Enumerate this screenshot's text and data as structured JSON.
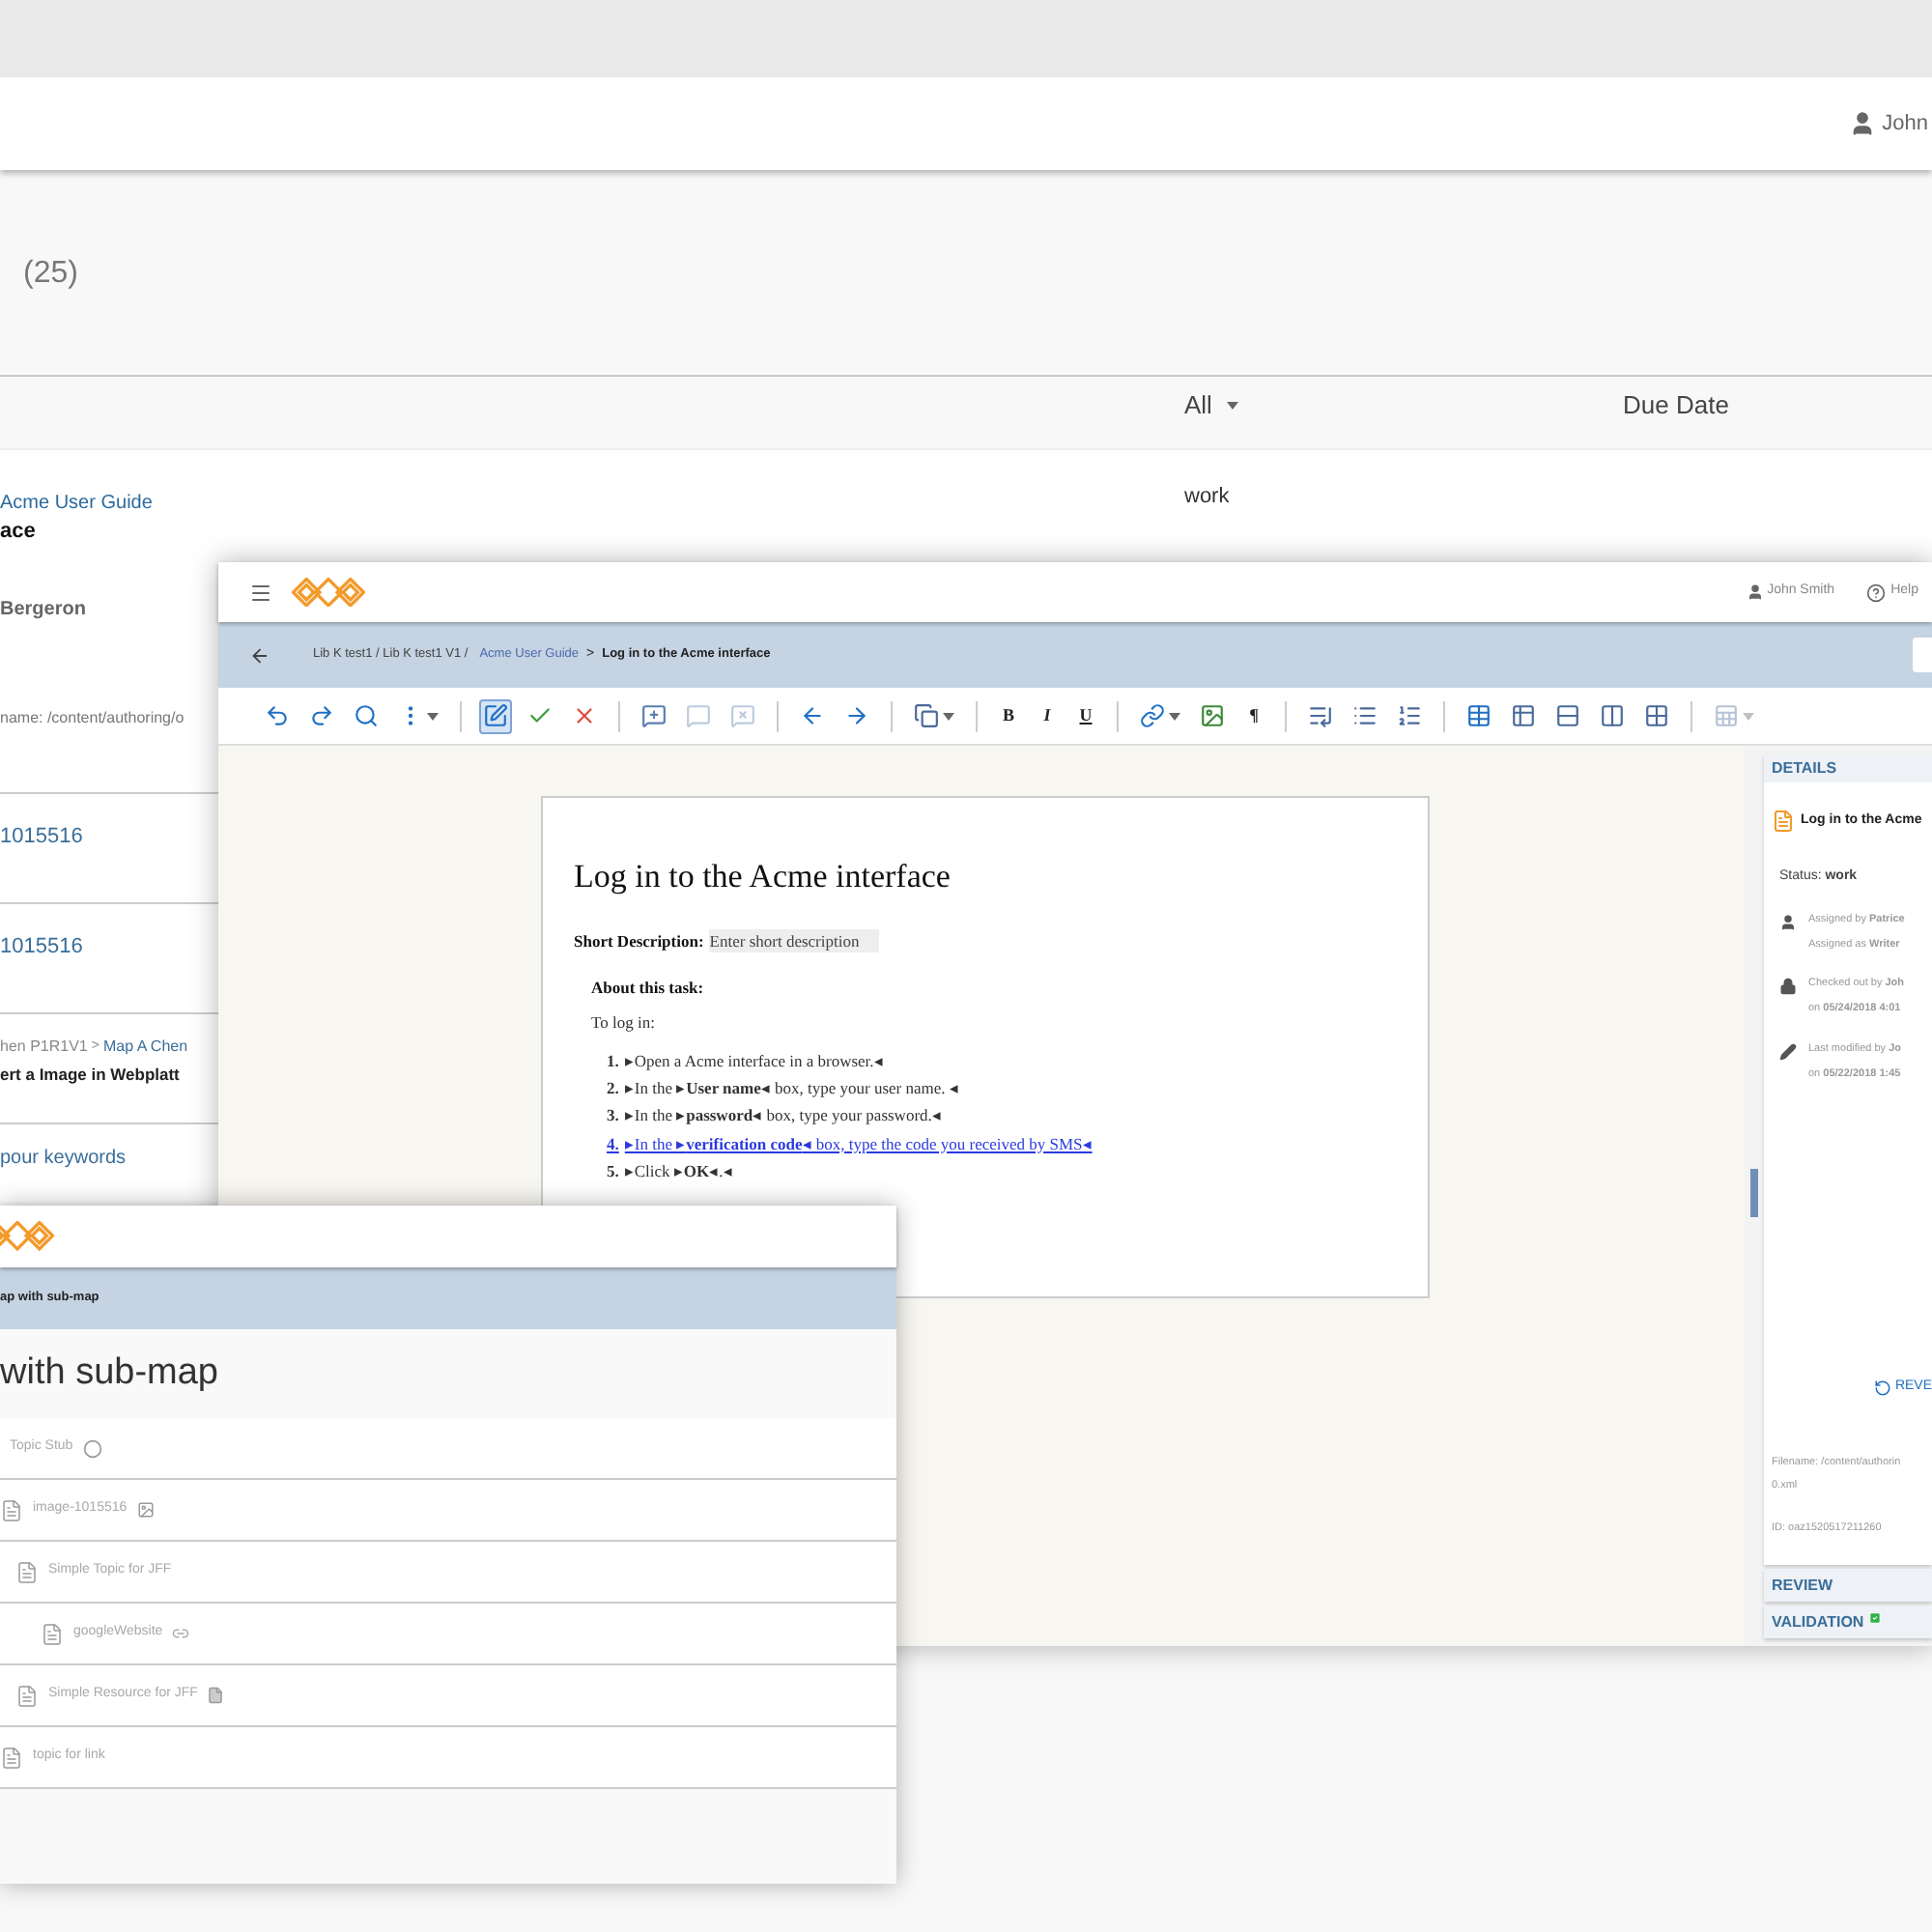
{
  "background_window": {
    "user": "John",
    "count": "(25)",
    "columns": [
      {
        "label": "All",
        "dropdown": true
      },
      {
        "label": "Due Date",
        "dropdown": false
      }
    ],
    "rows": [
      {
        "map": "Acme User Guide",
        "title": "ace",
        "status": "work",
        "author": "Bergeron",
        "filename": "name: /content/authoring/o"
      },
      {
        "title": "1015516",
        "kind": "link"
      },
      {
        "title": "1015516",
        "kind": "link"
      },
      {
        "path": "hen P1R1V1",
        "separator": ">",
        "map": "Map A Chen",
        "title": "ert a Image in Webplatt"
      },
      {
        "title": "pour keywords",
        "kind": "link"
      }
    ]
  },
  "editor_window": {
    "user": "John Smith",
    "help": "Help",
    "breadcrumb": {
      "path": "Lib K test1 / Lib K test1 V1 /",
      "link": "Acme User Guide",
      "separator": ">",
      "current": "Log in to the Acme interface"
    },
    "toolbar": [
      {
        "kind": "icon",
        "selected": false,
        "disabled": false,
        "dropdown": false
      },
      {
        "kind": "icon",
        "selected": false,
        "disabled": false,
        "dropdown": false
      },
      {
        "kind": "icon",
        "selected": false,
        "disabled": false,
        "dropdown": false
      },
      {
        "kind": "icon",
        "selected": false,
        "disabled": false,
        "dropdown": true
      },
      {
        "kind": "separator"
      },
      {
        "kind": "icon",
        "selected": true,
        "disabled": false,
        "dropdown": false
      },
      {
        "kind": "icon",
        "selected": false,
        "disabled": false,
        "dropdown": false
      },
      {
        "kind": "icon",
        "selected": false,
        "disabled": false,
        "dropdown": false
      },
      {
        "kind": "separator"
      },
      {
        "kind": "icon",
        "selected": false,
        "disabled": false,
        "dropdown": false
      },
      {
        "kind": "icon",
        "selected": false,
        "disabled": true,
        "dropdown": false
      },
      {
        "kind": "icon",
        "selected": false,
        "disabled": true,
        "dropdown": false
      },
      {
        "kind": "separator"
      },
      {
        "kind": "icon",
        "selected": false,
        "disabled": false,
        "dropdown": false
      },
      {
        "kind": "icon",
        "selected": false,
        "disabled": false,
        "dropdown": false
      },
      {
        "kind": "separator"
      },
      {
        "kind": "icon",
        "selected": false,
        "disabled": false,
        "dropdown": true
      },
      {
        "kind": "separator"
      },
      {
        "kind": "text",
        "label": "B"
      },
      {
        "kind": "text",
        "label": "I"
      },
      {
        "kind": "text",
        "label": "U"
      },
      {
        "kind": "separator"
      },
      {
        "kind": "icon",
        "selected": false,
        "disabled": false,
        "dropdown": true
      },
      {
        "kind": "icon",
        "selected": false,
        "disabled": false,
        "dropdown": false
      },
      {
        "kind": "text",
        "label": "¶"
      },
      {
        "kind": "separator"
      },
      {
        "kind": "icon",
        "selected": false,
        "disabled": false,
        "dropdown": false
      },
      {
        "kind": "icon",
        "selected": false,
        "disabled": false,
        "dropdown": false
      },
      {
        "kind": "icon",
        "selected": false,
        "disabled": false,
        "dropdown": false
      },
      {
        "kind": "separator"
      },
      {
        "kind": "icon",
        "selected": false,
        "disabled": false,
        "dropdown": false
      },
      {
        "kind": "icon",
        "selected": false,
        "disabled": false,
        "dropdown": false
      },
      {
        "kind": "icon",
        "selected": false,
        "disabled": false,
        "dropdown": false
      },
      {
        "kind": "icon",
        "selected": false,
        "disabled": false,
        "dropdown": false
      },
      {
        "kind": "icon",
        "selected": false,
        "disabled": false,
        "dropdown": false
      },
      {
        "kind": "separator"
      },
      {
        "kind": "icon",
        "selected": false,
        "disabled": true,
        "dropdown": true
      }
    ],
    "document": {
      "title": "Log in to the Acme interface",
      "short_label": "Short Description:",
      "short_placeholder": "Enter short description",
      "about": "About this task:",
      "intro": "To log in:",
      "steps": [
        {
          "number": "1.",
          "text": "▸Open a Acme interface in a browser.◂",
          "highlighted": false
        },
        {
          "number": "2.",
          "text": "▸In the ▸**User name**◂ box, type your user name. ◂",
          "highlighted": false
        },
        {
          "number": "3.",
          "text": "▸In the ▸**password**◂ box, type your password.◂",
          "highlighted": false
        },
        {
          "number": "4.",
          "text": "▸In the ▸**verification code**◂ box, type the code you received by SMS◂",
          "highlighted": true
        },
        {
          "number": "5.",
          "text": "▸Click ▸**OK**◂.◂",
          "highlighted": false
        }
      ]
    },
    "details": {
      "header": "DETAILS",
      "title": "Log in to the Acme",
      "status": "Status: **work**",
      "entries": [
        {
          "kind": "user",
          "lines": [
            "Assigned by **Patrice**",
            "Assigned as **Writer**"
          ]
        },
        {
          "kind": "lock",
          "lines": [
            "Checked out by **Joh**",
            "on **05/24/2018 4:01**"
          ]
        },
        {
          "kind": "pencil",
          "lines": [
            "Last modified by **Jo**",
            "on **05/22/2018 1:45**"
          ]
        }
      ],
      "revert": "REVE",
      "filename": [
        "Filename: /content/authorin",
        "0.xml"
      ],
      "id": "ID: oaz1520517211260",
      "sections": [
        {
          "label": "REVIEW",
          "valid": false
        },
        {
          "label": "VALIDATION",
          "valid": true
        }
      ]
    }
  },
  "map_window": {
    "breadcrumb": "ap with sub-map",
    "title": "with sub-map",
    "items": [
      {
        "label": "Topic Stub",
        "kind": "stub"
      },
      {
        "label": "image-1015516",
        "kind": "image",
        "children": [
          {
            "label": "Simple Topic for JFF",
            "kind": "topic",
            "children": [
              {
                "label": "googleWebsite",
                "kind": "link"
              }
            ]
          },
          {
            "label": "Simple Resource for JFF",
            "kind": "resource"
          }
        ]
      },
      {
        "label": "topic for link",
        "kind": "topic"
      }
    ]
  }
}
